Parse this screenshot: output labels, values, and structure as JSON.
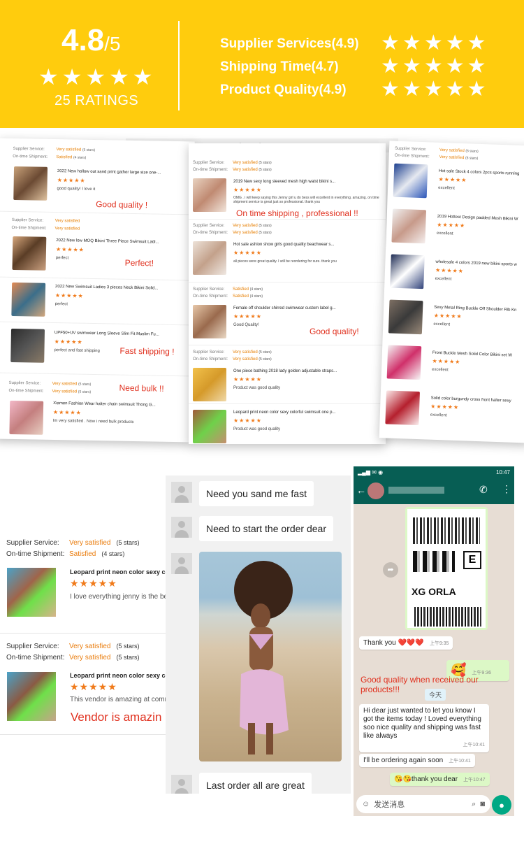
{
  "banner": {
    "score": "4.8",
    "out_of": "/5",
    "ratings": "25 RATINGS",
    "metrics": [
      {
        "label": "Supplier Services(4.9)",
        "stars": "★★★★★"
      },
      {
        "label": "Shipping Time(4.7)",
        "stars": "★★★★★"
      },
      {
        "label": "Product Quality(4.9)",
        "stars": "★★★★★"
      }
    ],
    "main_stars": "★★★★★"
  },
  "labels": {
    "supplier_service": "Supplier Service:",
    "ontime_shipment": "On-time Shipment:",
    "very_satisfied": "Very satisfied",
    "satisfied": "Satisfied",
    "five_stars": "(5 stars)",
    "four_stars": "(4 stars)",
    "stars5": "★★★★★"
  },
  "card1": {
    "items": [
      {
        "title": "2022 New hollow out sand print gather large size one-...",
        "comment": "good quality! I love it",
        "hand": "Good quality !"
      },
      {
        "title": "2022 New low MOQ Bikini Three Piece Swimsuit Ladi...",
        "comment": "perfect",
        "hand": "Perfect!"
      },
      {
        "title": "2022 New Swimsuit Ladies 3 pieces Neck Bikini Solid...",
        "comment": "perfect",
        "hand": ""
      },
      {
        "title": "UPF50+UV swimwear Long Sleeve Slim Fit Muslim Fu...",
        "comment": "perfect and fast shipping",
        "hand": "Fast shipping !"
      },
      {
        "title": "Xiamen Fashion Wear halter chain swimsuit Thong G...",
        "comment": "Im very satisfied . Now i need bulk products",
        "hand": "Need bulk !!"
      }
    ]
  },
  "card2": {
    "items": [
      {
        "title": "2019 New sexy long sleeved mesh high waist bikini s...",
        "comment": "OMG . i will keep saying this Jenny girl u do bess will excellent in everything. amazing. on time shipment service is great just so professional. thank you",
        "hand": "On time shipping , professional !!"
      },
      {
        "title": "Hot sale ashion show girls good quality beachwear s...",
        "comment": "all pieces were great quality. I will be reordering for sure. thank you",
        "hand": ""
      },
      {
        "title": "Female off shoulder shirred swimwear custom label g...",
        "comment": "Good Quality!",
        "hand": "Good quality!"
      },
      {
        "title": "One piece bathing 2018 lady golden adjustable straps...",
        "comment": "Product was good quality",
        "hand": ""
      },
      {
        "title": "Leopard print neon color sexy colorful swimsuit one p...",
        "comment": "Product was good quality",
        "hand": ""
      }
    ]
  },
  "card3": {
    "items": [
      {
        "title": "Hot sale Stock 4 colors 2pcs sports running",
        "comment": "excellent"
      },
      {
        "title": "2019 Hottest Design padded Mesh Bikini W",
        "comment": "excellent"
      },
      {
        "title": "wholesale 4 colors 2019 new bikini sports w",
        "comment": "excellent"
      },
      {
        "title": "Sexy Metal Ring Buckle Off Shoulder Rib Kn",
        "comment": "excellent"
      },
      {
        "title": "Front Buckle Mesh Solid Color Bikini set W",
        "comment": "excellent"
      },
      {
        "title": "Solid color burgundy cross front halter sexy",
        "comment": "excellent"
      }
    ]
  },
  "lower": {
    "items": [
      {
        "title": "Leopard print neon color sexy co",
        "comment": "I love everything jenny is the bes",
        "hand": "",
        "svc": "Very satisfied",
        "svc_n": "(5 stars)",
        "ship": "Satisfied",
        "ship_n": "(4 stars)"
      },
      {
        "title": "Leopard print neon color sexy co",
        "comment": "This vendor is amazing at comm",
        "hand": "Vendor is amazin",
        "svc": "Very satisfied",
        "svc_n": "(5 stars)",
        "ship": "Very satisfied",
        "ship_n": "(5 stars)"
      }
    ]
  },
  "chat": {
    "msg1": "Need you sand me fast",
    "msg2": "Need to start the order dear",
    "msg3": "Last order all are great"
  },
  "whatsapp": {
    "time": "10:47",
    "label_text": "XG ORLA",
    "msgs": [
      {
        "text": "Thank you ❤️❤️❤️",
        "time": "上午9:35"
      },
      {
        "text": "🥰",
        "time": "上午9:36"
      },
      {
        "text": "Good quality when received our products!!!",
        "time": ""
      },
      {
        "text": "今天",
        "time": ""
      },
      {
        "text": "Hi dear just wanted to let you know I got the items today ! Loved everything soo nice quality and shipping was fast like always",
        "time": "上午10:41"
      },
      {
        "text": "I'll be ordering again soon",
        "time": "上午10:41"
      },
      {
        "text": "😘😘thank you dear",
        "time": "上午10:47"
      }
    ],
    "input_placeholder": "发送消息"
  },
  "colors": {
    "banner": "#ffcc0d",
    "orange": "#e67e00",
    "red": "#e0301e",
    "wa_green": "#075e54"
  }
}
